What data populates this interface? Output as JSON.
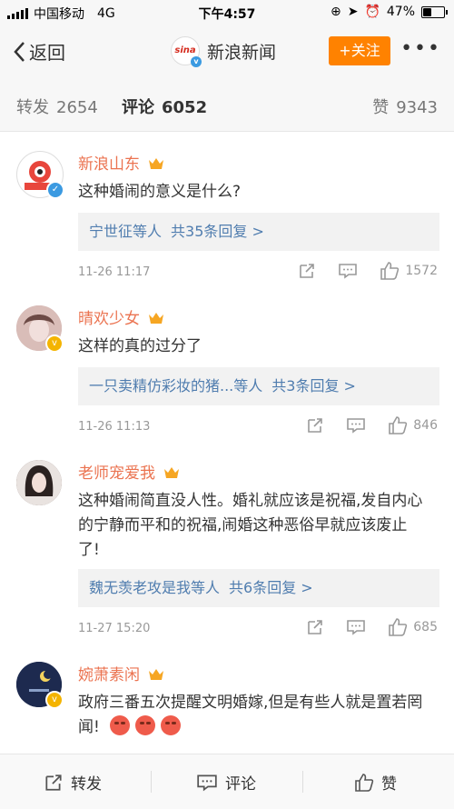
{
  "status_bar": {
    "carrier": "中国移动",
    "network": "4G",
    "time": "下午4:57",
    "battery": "47%",
    "battery_level": 0.47
  },
  "nav": {
    "back_label": "返回",
    "account_name": "新浪新闻",
    "logo_text": "sina",
    "follow_label": "+关注",
    "more_label": "•••"
  },
  "tabs": [
    {
      "label": "转发",
      "count": "2654"
    },
    {
      "label": "评论",
      "count": "6052",
      "active": true
    },
    {
      "label": "赞",
      "count": "9343"
    }
  ],
  "comments": [
    {
      "name": "新浪山东",
      "text": "这种婚闹的意义是什么?",
      "replies_who": "宁世征等人",
      "replies_count": "共35条回复 >",
      "time": "11-26 11:17",
      "likes": "1572",
      "avatar_color": "#e8463c",
      "badge_color": "#3b9ae1"
    },
    {
      "name": "晴欢少女",
      "text": "这样的真的过分了",
      "replies_who": "一只卖精仿彩妆的猪...等人",
      "replies_count": "共3条回复 >",
      "time": "11-26 11:13",
      "likes": "846",
      "avatar_color": "#caa9a6",
      "badge_color": "#f4b400"
    },
    {
      "name": "老师宠爱我",
      "text": "这种婚闹简直没人性。婚礼就应该是祝福,发自内心的宁静而平和的祝福,闹婚这种恶俗早就应该废止了!",
      "replies_who": "魏无羡老攻是我等人",
      "replies_count": "共6条回复 >",
      "time": "11-27 15:20",
      "likes": "685",
      "avatar_color": "#6b5650",
      "badge_color": ""
    },
    {
      "name": "婉萧素闲",
      "text": "政府三番五次提醒文明婚嫁,但是有些人就是置若罔闻!",
      "avatar_color": "#1d2a4f",
      "badge_color": "#f4b400"
    }
  ],
  "bottom_bar": {
    "repost": "转发",
    "comment": "评论",
    "like": "赞"
  },
  "colors": {
    "accent": "#ff8200",
    "username": "#eb7350",
    "link": "#507daf"
  }
}
